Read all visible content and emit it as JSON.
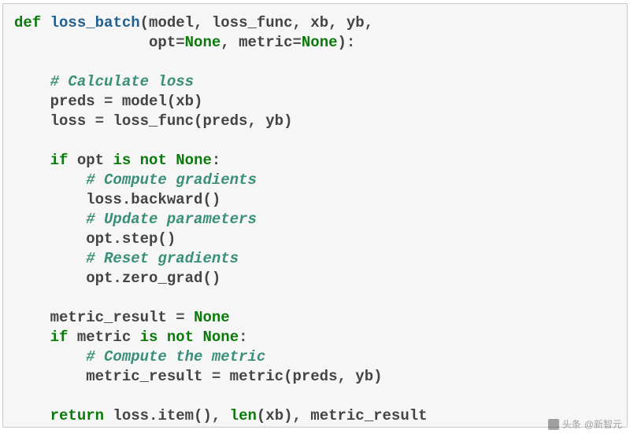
{
  "code": {
    "l1": {
      "kw_def": "def",
      "fn": "loss_batch",
      "params1": "(model, loss_func, xb, yb,"
    },
    "l2": {
      "indent": "               ",
      "p_opt": "opt",
      "eq1": "=",
      "none1": "None",
      "sep": ", ",
      "p_metric": "metric",
      "eq2": "=",
      "none2": "None",
      "close": "):"
    },
    "l4": {
      "indent": "    ",
      "comment": "# Calculate loss"
    },
    "l5": {
      "indent": "    ",
      "lhs": "preds ",
      "op": "=",
      "rhs": " model(xb)"
    },
    "l6": {
      "indent": "    ",
      "lhs": "loss ",
      "op": "=",
      "rhs": " loss_func(preds, yb)"
    },
    "l8": {
      "indent": "    ",
      "kw_if": "if",
      "var": " opt ",
      "kw_is": "is",
      "sp": " ",
      "kw_not": "not",
      "sp2": " ",
      "none": "None",
      "colon": ":"
    },
    "l9": {
      "indent": "        ",
      "comment": "# Compute gradients"
    },
    "l10": {
      "indent": "        ",
      "text": "loss.backward()"
    },
    "l11": {
      "indent": "        ",
      "comment": "# Update parameters"
    },
    "l12": {
      "indent": "        ",
      "text": "opt.step()"
    },
    "l13": {
      "indent": "        ",
      "comment": "# Reset gradients"
    },
    "l14": {
      "indent": "        ",
      "text": "opt.zero_grad()"
    },
    "l16": {
      "indent": "    ",
      "lhs": "metric_result ",
      "op": "=",
      "sp": " ",
      "val": "None"
    },
    "l17": {
      "indent": "    ",
      "kw_if": "if",
      "var": " metric ",
      "kw_is": "is",
      "sp": " ",
      "kw_not": "not",
      "sp2": " ",
      "none": "None",
      "colon": ":"
    },
    "l18": {
      "indent": "        ",
      "comment": "# Compute the metric"
    },
    "l19": {
      "indent": "        ",
      "lhs": "metric_result ",
      "op": "=",
      "rhs": " metric(preds, yb)"
    },
    "l21": {
      "indent": "    ",
      "kw_return": "return",
      "r1": " loss.item(), ",
      "bi": "len",
      "r2": "(xb), metric_result"
    }
  },
  "watermark": {
    "prefix": "头条",
    "handle": "@新智元"
  }
}
